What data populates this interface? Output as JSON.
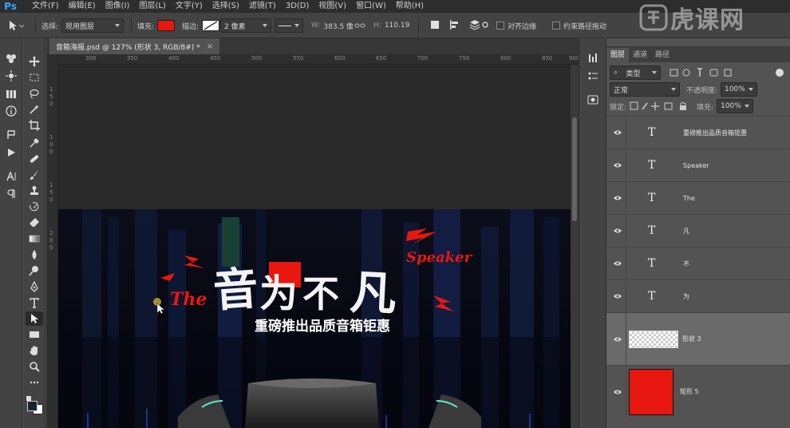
{
  "app": {
    "logo": "Ps"
  },
  "menu": [
    "文件(F)",
    "编辑(E)",
    "图像(I)",
    "图层(L)",
    "文字(Y)",
    "选择(S)",
    "滤镜(T)",
    "3D(D)",
    "视图(V)",
    "窗口(W)",
    "帮助(H)"
  ],
  "options": {
    "select_label": "选择:",
    "select_value": "现用图层",
    "fill_label": "填充:",
    "fill_color": "#e8170f",
    "stroke_label": "描边:",
    "stroke_width": "2 像素",
    "w_label": "W:",
    "w_value": "383.5 像",
    "h_label": "H:",
    "h_value": "110.19",
    "align_edges": "对齐边缘",
    "constrain_path": "约束路径拖动"
  },
  "document": {
    "tab_title": "音箱海报.psd @ 127% (形状 3, RGB/8#) *",
    "ruler_h": [
      "300",
      "350",
      "400",
      "450",
      "500",
      "550",
      "600",
      "650",
      "700",
      "750",
      "800",
      "850",
      "900"
    ],
    "ruler_v": [
      "1",
      "5",
      "0",
      "1",
      "0",
      "0",
      "1",
      "5",
      "0",
      "2",
      "0",
      "0"
    ]
  },
  "poster": {
    "word_the": "The",
    "title_chars": [
      "音",
      "为",
      "不",
      "凡"
    ],
    "word_speaker": "Speaker",
    "subtitle": "重磅推出品质音箱钜惠",
    "accent": "#e8170f"
  },
  "layers_panel": {
    "tabs": [
      "图层",
      "通道",
      "路径"
    ],
    "filter_label": "类型",
    "blend_mode": "正常",
    "opacity_label": "不透明度:",
    "opacity_value": "100%",
    "lock_label": "锁定:",
    "fill_label": "填充:",
    "fill_value": "100%",
    "layers": [
      {
        "type": "text",
        "name": "重磅推出品质音箱钜惠",
        "selected": false
      },
      {
        "type": "text",
        "name": "Speaker",
        "selected": false
      },
      {
        "type": "text",
        "name": "The",
        "selected": false
      },
      {
        "type": "text",
        "name": "凡",
        "selected": false
      },
      {
        "type": "text",
        "name": "不",
        "selected": false
      },
      {
        "type": "text",
        "name": "为",
        "selected": false
      },
      {
        "type": "shape",
        "name": "形状 3",
        "selected": true
      },
      {
        "type": "rect",
        "name": "矩形 5",
        "selected": false
      }
    ]
  },
  "watermark": "虎课网"
}
